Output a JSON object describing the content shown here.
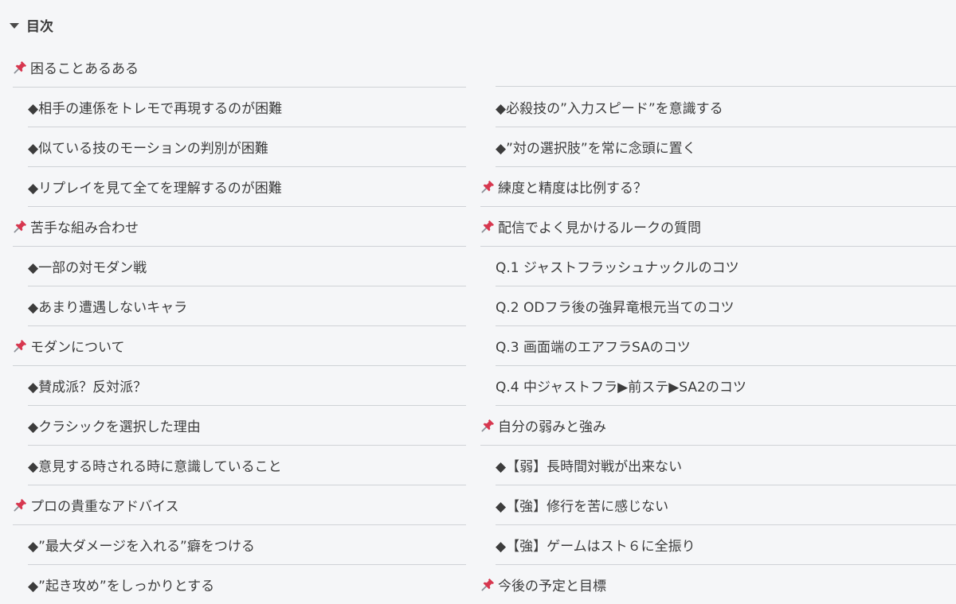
{
  "toc": {
    "title": "目次"
  },
  "icons": {
    "caret": "caret-down-icon",
    "pin": "pushpin-icon",
    "pin_color": "#d7374f",
    "text_color": "#3c3c3c",
    "divider_color": "#cfd2d6",
    "background": "#f5f6f8"
  },
  "left_items": [
    {
      "type": "section",
      "text": "困ることあるある"
    },
    {
      "type": "sub",
      "text": "◆相手の連係をトレモで再現するのが困難"
    },
    {
      "type": "sub",
      "text": "◆似ている技のモーションの判別が困難"
    },
    {
      "type": "sub",
      "text": "◆リプレイを見て全てを理解するのが困難"
    },
    {
      "type": "section",
      "text": "苦手な組み合わせ"
    },
    {
      "type": "sub",
      "text": "◆一部の対モダン戦"
    },
    {
      "type": "sub",
      "text": "◆あまり遭遇しないキャラ"
    },
    {
      "type": "section",
      "text": "モダンについて"
    },
    {
      "type": "sub",
      "text": "◆賛成派？反対派？"
    },
    {
      "type": "sub",
      "text": "◆クラシックを選択した理由"
    },
    {
      "type": "sub",
      "text": "◆意見する時される時に意識していること"
    },
    {
      "type": "section",
      "text": "プロの貴重なアドバイス"
    },
    {
      "type": "sub",
      "text": "◆”最大ダメージを入れる”癖をつける"
    },
    {
      "type": "sub",
      "text": "◆”起き攻め”をしっかりとする"
    }
  ],
  "right_items": [
    {
      "type": "sub",
      "text": "◆必殺技の”入力スピード”を意識する"
    },
    {
      "type": "sub",
      "text": "◆”対の選択肢”を常に念頭に置く"
    },
    {
      "type": "section",
      "text": "練度と精度は比例する？"
    },
    {
      "type": "section",
      "text": "配信でよく見かけるルークの質問"
    },
    {
      "type": "sub",
      "text": "Q.1 ジャストフラッシュナックルのコツ"
    },
    {
      "type": "sub",
      "text": "Q.2 ODフラ後の強昇竜根元当てのコツ"
    },
    {
      "type": "sub",
      "text": "Q.3 画面端のエアフラSAのコツ"
    },
    {
      "type": "sub",
      "text": "Q.4 中ジャストフラ▶前ステ▶SA2のコツ"
    },
    {
      "type": "section",
      "text": "自分の弱みと強み"
    },
    {
      "type": "sub",
      "text": "◆【弱】長時間対戦が出来ない"
    },
    {
      "type": "sub",
      "text": "◆【強】修行を苦に感じない"
    },
    {
      "type": "sub",
      "text": "◆【強】ゲームはスト６に全振り"
    },
    {
      "type": "section",
      "text": "今後の予定と目標"
    }
  ]
}
